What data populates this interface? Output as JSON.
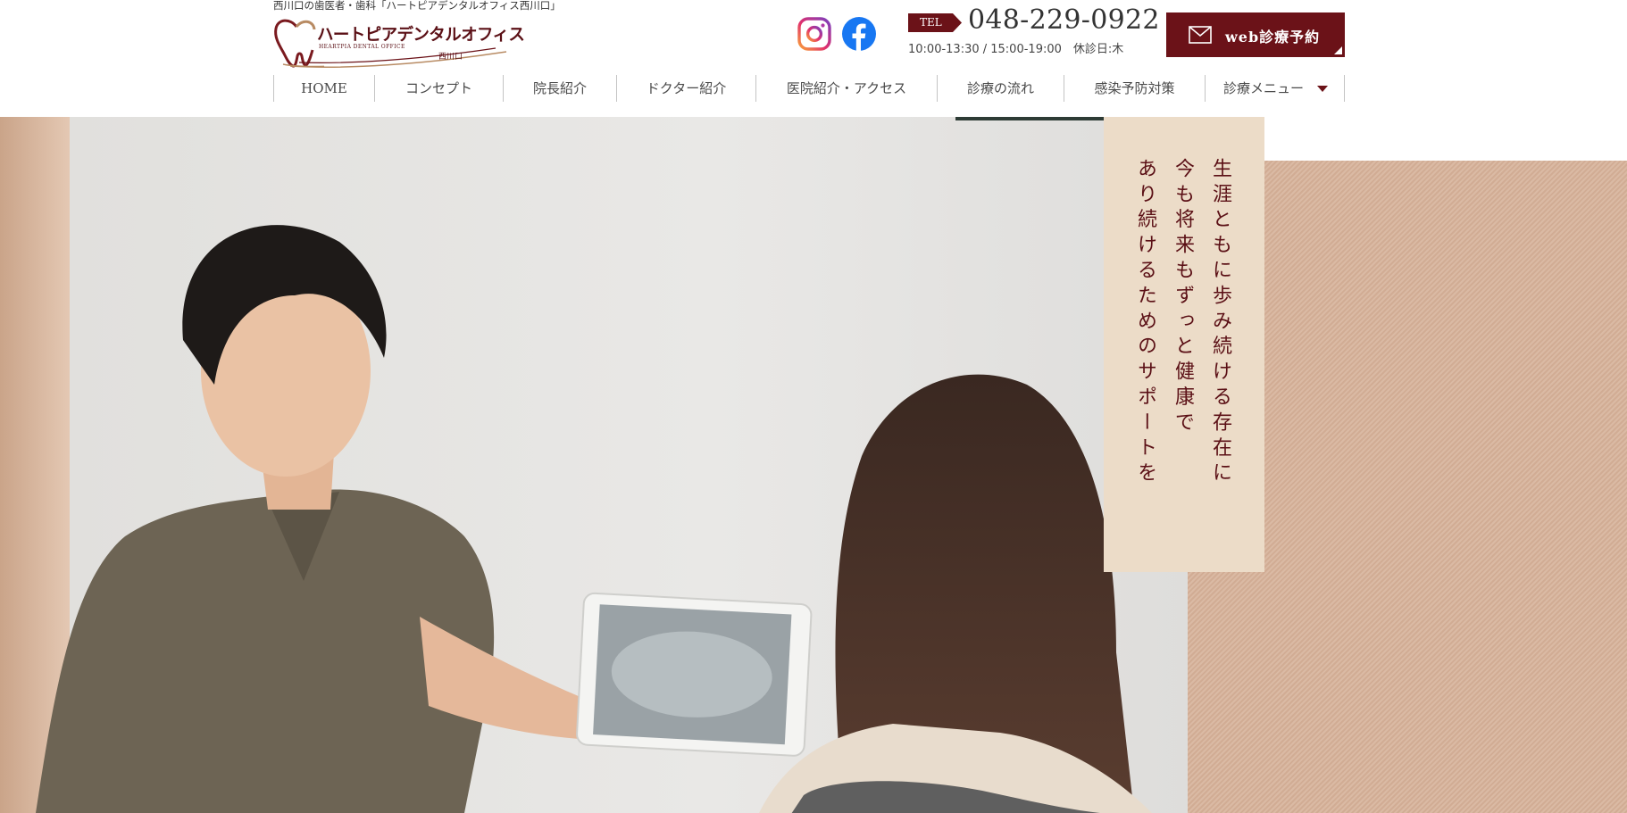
{
  "header": {
    "site_description": "西川口の歯医者・歯科「ハートピアデンタルオフィス西川口」",
    "logo": {
      "name": "ハートピアデンタルオフィス",
      "english": "HEARTPIA DENTAL OFFICE",
      "branch": "西川口",
      "icon": "heart-tooth-icon"
    },
    "sns": [
      {
        "name": "Instagram",
        "icon": "instagram-icon"
      },
      {
        "name": "Facebook",
        "icon": "facebook-icon"
      }
    ],
    "tel_label": "TEL",
    "tel_number": "048-229-0922",
    "hours": "10:00-13:30 / 15:00-19:00　休診日:木",
    "web_reservation": {
      "label": "web診療予約",
      "icon": "mail-icon"
    }
  },
  "nav": {
    "items": [
      {
        "label": "HOME"
      },
      {
        "label": "コンセプト"
      },
      {
        "label": "院長紹介"
      },
      {
        "label": "ドクター紹介"
      },
      {
        "label": "医院紹介・アクセス"
      },
      {
        "label": "診療の流れ"
      },
      {
        "label": "感染予防対策"
      },
      {
        "label": "診療メニュー",
        "icon": "caret-down-icon"
      }
    ]
  },
  "hero": {
    "catch_lines": [
      "生涯ともに歩み続ける存在に",
      "今も将来もずっと健康で",
      "あり続けるためのサポートを"
    ]
  },
  "colors": {
    "brand": "#6b1218",
    "catch_box": "#ecdcc8",
    "side_panel": "#d6b29a"
  }
}
